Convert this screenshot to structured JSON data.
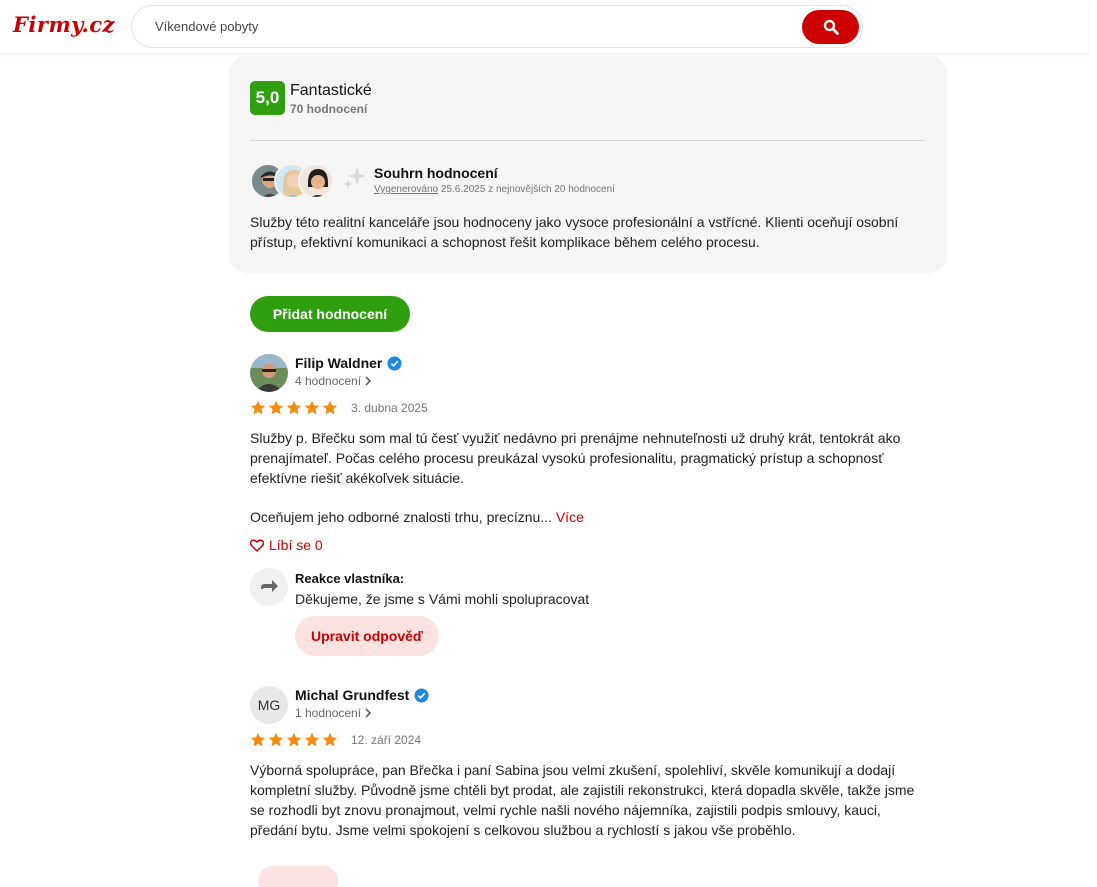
{
  "header": {
    "logo": "Firmy.cz",
    "search_value": "Víkendové pobyty",
    "search_icon": "search-icon"
  },
  "summary": {
    "score": "5,0",
    "score_label": "Fantastické",
    "rating_count": "70 hodnocení",
    "title": "Souhrn hodnocení",
    "generated_link": "Vygenerováno",
    "generated_meta": " 25.6.2025 z nejnovějších 20 hodnocení",
    "text": "Služby této realitní kanceláře jsou hodnoceny jako vysoce profesionální a vstřícné. Klienti oceňují osobní přístup, efektivní komunikaci a schopnost řešit komplikace během celého procesu.",
    "score_color": "#2f9e0f"
  },
  "add_review": {
    "label": "Přidat hodnocení"
  },
  "reviews": [
    {
      "name": "Filip Waldner",
      "count": "4 hodnocení",
      "stars": 5,
      "date": "3. dubna 2025",
      "text_p1": "Služby p. Břečku som mal tú česť využiť nedávno pri prenájme nehnuteľnosti už druhý krát, tentokrát ako prenajímateľ. Počas celého procesu preukázal vysokú profesionalitu, pragmatický prístup a schopnosť efektívne riešiť akékoľvek situácie.",
      "text_p2": "Oceňujem jeho odborné znalosti trhu, precíznu...",
      "more": " Více",
      "like": "Líbí se 0",
      "owner_title": "Reakce vlastníka:",
      "owner_text": "Děkujeme, že jsme s Vámi mohli spolupracovat",
      "edit_label": "Upravit odpověď"
    },
    {
      "name": "Michal Grundfest",
      "initials": "MG",
      "count": "1 hodnocení",
      "stars": 5,
      "date": "12. září 2024",
      "text_p1": "Výborná spolupráce, pan Břečka i paní Sabina jsou velmi zkušení, spolehliví, skvěle komunikují a dodají kompletní služby. Původně jsme chtěli byt prodat, ale zajistili rekonstrukci, která dopadla skvěle, takže jsme se rozhodli byt znovu pronajmout, velmi rychle našli nového nájemníka, zajistili podpis smlouvy, kauci, předání bytu. Jsme velmi spokojení s celkovou službou a rychlostí s jakou vše proběhlo."
    }
  ],
  "colors": {
    "brand_red": "#cc0000",
    "star": "#f28c0f",
    "verified": "#1e88e5"
  }
}
